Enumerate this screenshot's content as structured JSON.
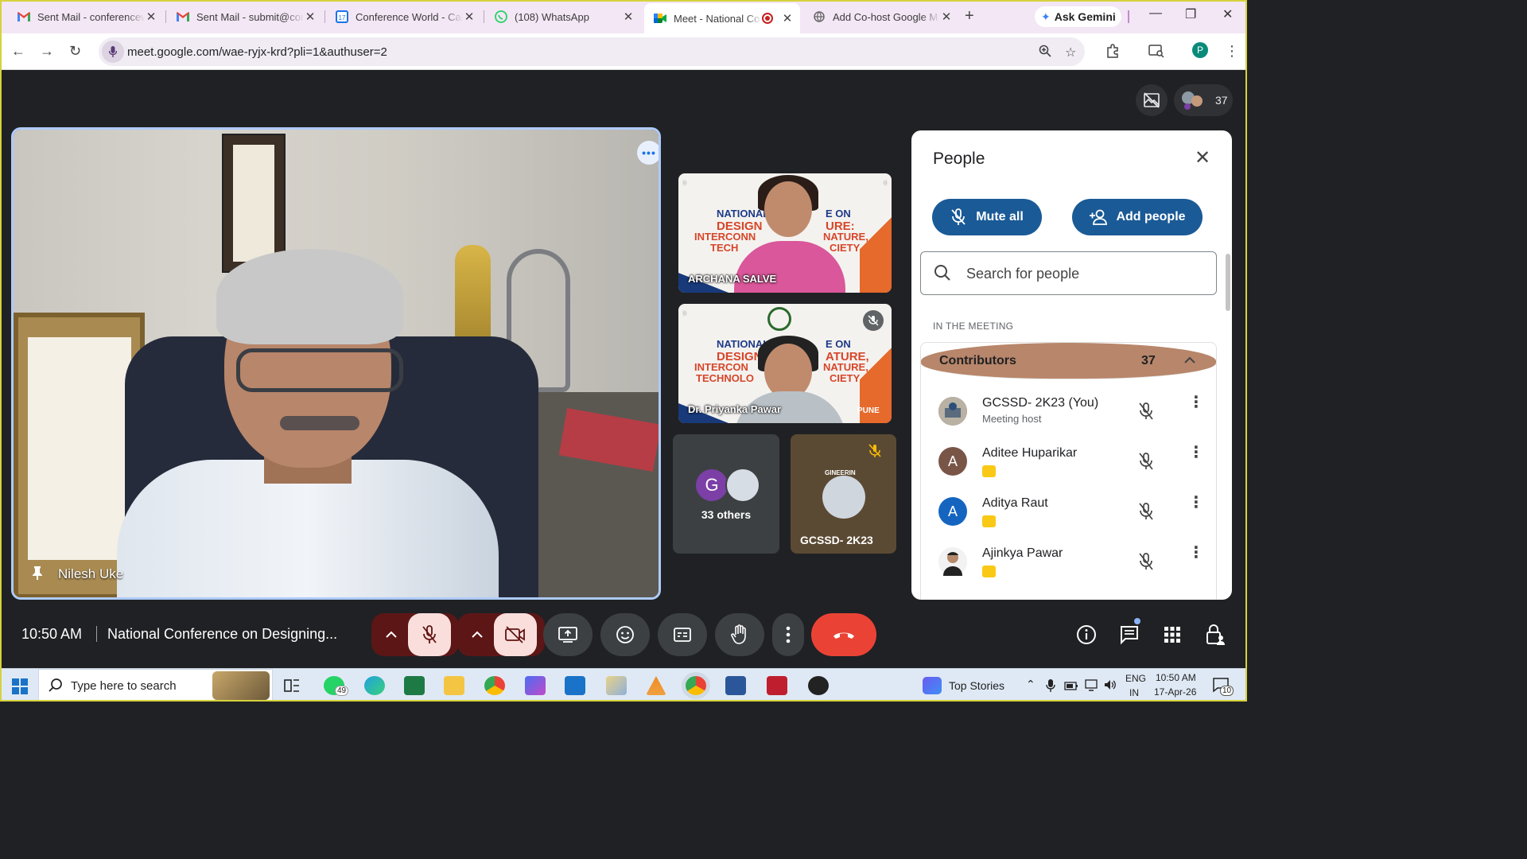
{
  "browser": {
    "tabs": [
      {
        "title": "Sent Mail - conferencew",
        "icon": "gmail-icon"
      },
      {
        "title": "Sent Mail - submit@conf",
        "icon": "gmail-icon"
      },
      {
        "title": "Conference World - Cal",
        "icon": "calendar-icon"
      },
      {
        "title": "(108) WhatsApp",
        "icon": "whatsapp-icon"
      },
      {
        "title": "Meet - National Co",
        "icon": "meet-icon"
      },
      {
        "title": "Add Co-host Google M",
        "icon": "web-icon"
      }
    ],
    "new_tab": "+",
    "gemini": "Ask Gemini",
    "url": "meet.google.com/wae-ryjx-krd?pli=1&authuser=2",
    "profile_initial": "P"
  },
  "meet": {
    "participant_count": "37",
    "main_tile_name": "Nilesh Uke",
    "tiles": [
      {
        "name": "ARCHANA SALVE",
        "banner1": "NATIONAL",
        "banner2": "E ON",
        "banner3": "DESIGN",
        "banner4": "URE:",
        "banner5": "INTERCONN",
        "banner6": "NATURE,",
        "banner7": "TECH",
        "banner8": "CIETY"
      },
      {
        "name": "Dr. Priyanka Pawar",
        "banner1": "NATIONAL",
        "banner2": "E ON",
        "banner3": "DESIGN",
        "banner4": "ATURE,",
        "banner5": "INTERCON",
        "banner6": "NATURE,",
        "banner7": "TECHNOLO",
        "banner8": "CIETY",
        "footer": "PUNE"
      }
    ],
    "others_initial": "G",
    "others_label": "33 others",
    "host_tile_name": "GCSSD- 2K23",
    "host_logo_text": "GINEERIN",
    "time": "10:50 AM",
    "meeting_title": "National Conference on Designing..."
  },
  "people_panel": {
    "title": "People",
    "mute_all": "Mute all",
    "add_people": "Add people",
    "search_placeholder": "Search for people",
    "section": "IN THE MEETING",
    "group": "Contributors",
    "group_count": "37",
    "participants": [
      {
        "name": "GCSSD- 2K23 (You)",
        "sub": "Meeting host",
        "initial": "",
        "color": "#8a7a66"
      },
      {
        "name": "Aditee Huparikar",
        "sub": "",
        "initial": "A",
        "color": "#795548"
      },
      {
        "name": "Aditya Raut",
        "sub": "",
        "initial": "A",
        "color": "#1565c0"
      },
      {
        "name": "Ajinkya Pawar",
        "sub": "",
        "initial": "",
        "color": "#e9e9e9"
      }
    ]
  },
  "taskbar": {
    "search": "Type here to search",
    "whatsapp_badge": "49",
    "top_stories": "Top Stories",
    "lang1": "ENG",
    "lang2": "IN",
    "clock_time": "10:50 AM",
    "clock_date": "17-Apr-26",
    "notification_count": "10"
  },
  "colors": {
    "accent_blue": "#1a5a96",
    "end_call_red": "#ea4335",
    "tile_border": "#aecbfa",
    "tab_strip": "#f3e6f5"
  }
}
